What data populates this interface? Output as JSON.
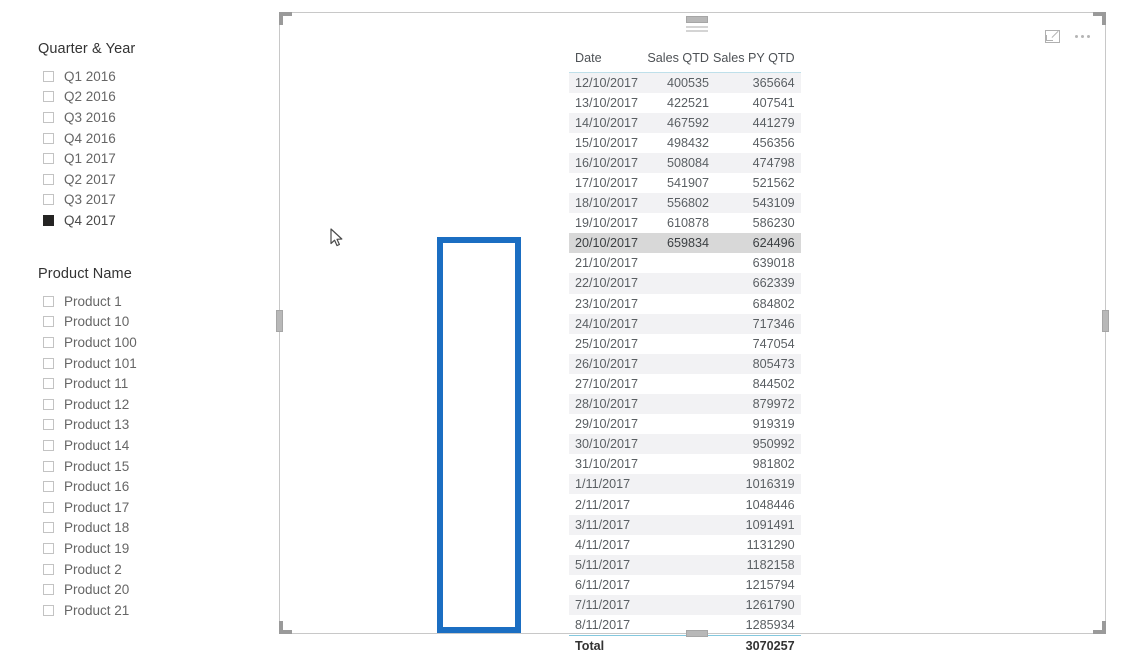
{
  "slicers": [
    {
      "name": "quarter-year",
      "title": "Quarter & Year",
      "items": [
        {
          "label": "Q1 2016",
          "checked": false
        },
        {
          "label": "Q2 2016",
          "checked": false
        },
        {
          "label": "Q3 2016",
          "checked": false
        },
        {
          "label": "Q4 2016",
          "checked": false
        },
        {
          "label": "Q1 2017",
          "checked": false
        },
        {
          "label": "Q2 2017",
          "checked": false
        },
        {
          "label": "Q3 2017",
          "checked": false
        },
        {
          "label": "Q4 2017",
          "checked": true
        }
      ]
    },
    {
      "name": "product-name",
      "title": "Product Name",
      "items": [
        {
          "label": "Product 1",
          "checked": false
        },
        {
          "label": "Product 10",
          "checked": false
        },
        {
          "label": "Product 100",
          "checked": false
        },
        {
          "label": "Product 101",
          "checked": false
        },
        {
          "label": "Product 11",
          "checked": false
        },
        {
          "label": "Product 12",
          "checked": false
        },
        {
          "label": "Product 13",
          "checked": false
        },
        {
          "label": "Product 14",
          "checked": false
        },
        {
          "label": "Product 15",
          "checked": false
        },
        {
          "label": "Product 16",
          "checked": false
        },
        {
          "label": "Product 17",
          "checked": false
        },
        {
          "label": "Product 18",
          "checked": false
        },
        {
          "label": "Product 19",
          "checked": false
        },
        {
          "label": "Product 2",
          "checked": false
        },
        {
          "label": "Product 20",
          "checked": false
        },
        {
          "label": "Product 21",
          "checked": false
        }
      ]
    }
  ],
  "visual": {
    "header_icons": [
      {
        "name": "focus-mode-icon",
        "label": "Focus mode"
      },
      {
        "name": "more-options-icon",
        "label": "More options"
      }
    ],
    "table": {
      "columns": [
        "Date",
        "Sales QTD",
        "Sales PY QTD"
      ],
      "rows": [
        {
          "date": "12/10/2017",
          "qtd": "400535",
          "py": "365664"
        },
        {
          "date": "13/10/2017",
          "qtd": "422521",
          "py": "407541"
        },
        {
          "date": "14/10/2017",
          "qtd": "467592",
          "py": "441279"
        },
        {
          "date": "15/10/2017",
          "qtd": "498432",
          "py": "456356"
        },
        {
          "date": "16/10/2017",
          "qtd": "508084",
          "py": "474798"
        },
        {
          "date": "17/10/2017",
          "qtd": "541907",
          "py": "521562"
        },
        {
          "date": "18/10/2017",
          "qtd": "556802",
          "py": "543109"
        },
        {
          "date": "19/10/2017",
          "qtd": "610878",
          "py": "586230"
        },
        {
          "date": "20/10/2017",
          "qtd": "659834",
          "py": "624496",
          "hover": true
        },
        {
          "date": "21/10/2017",
          "qtd": "",
          "py": "639018"
        },
        {
          "date": "22/10/2017",
          "qtd": "",
          "py": "662339"
        },
        {
          "date": "23/10/2017",
          "qtd": "",
          "py": "684802"
        },
        {
          "date": "24/10/2017",
          "qtd": "",
          "py": "717346"
        },
        {
          "date": "25/10/2017",
          "qtd": "",
          "py": "747054"
        },
        {
          "date": "26/10/2017",
          "qtd": "",
          "py": "805473"
        },
        {
          "date": "27/10/2017",
          "qtd": "",
          "py": "844502"
        },
        {
          "date": "28/10/2017",
          "qtd": "",
          "py": "879972"
        },
        {
          "date": "29/10/2017",
          "qtd": "",
          "py": "919319"
        },
        {
          "date": "30/10/2017",
          "qtd": "",
          "py": "950992"
        },
        {
          "date": "31/10/2017",
          "qtd": "",
          "py": "981802"
        },
        {
          "date": "1/11/2017",
          "qtd": "",
          "py": "1016319"
        },
        {
          "date": "2/11/2017",
          "qtd": "",
          "py": "1048446"
        },
        {
          "date": "3/11/2017",
          "qtd": "",
          "py": "1091491"
        },
        {
          "date": "4/11/2017",
          "qtd": "",
          "py": "1131290"
        },
        {
          "date": "5/11/2017",
          "qtd": "",
          "py": "1182158"
        },
        {
          "date": "6/11/2017",
          "qtd": "",
          "py": "1215794"
        },
        {
          "date": "7/11/2017",
          "qtd": "",
          "py": "1261790"
        },
        {
          "date": "8/11/2017",
          "qtd": "",
          "py": "1285934"
        }
      ],
      "total": {
        "date": "Total",
        "qtd": "",
        "py": "3070257"
      }
    }
  },
  "annotation": {
    "name": "highlight-box",
    "color": "#1b6ec2",
    "target_column": "Sales PY QTD"
  },
  "scrollbar": {
    "up_glyph": "⌃",
    "down_glyph": "⌄"
  },
  "colors": {
    "accent_blue": "#1b6ec2",
    "row_alt": "#f2f2f4",
    "hover_row": "#d8d8d8",
    "header_rule": "#bfe0ea",
    "total_rule": "#84c8de",
    "text": "#5a5f63",
    "slicer_text": "#666666",
    "checkbox_checked": "#252423"
  }
}
